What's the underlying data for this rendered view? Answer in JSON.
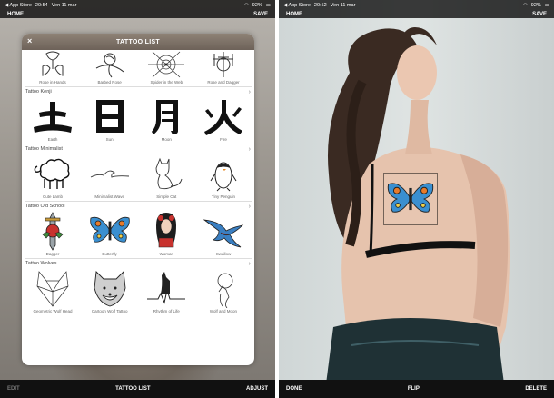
{
  "left": {
    "status": {
      "carrier": "◀ App Store",
      "time": "20:54",
      "date": "Ven 11 mar",
      "battery": "92%"
    },
    "topbar": {
      "home": "HOME",
      "save": "SAVE"
    },
    "panel": {
      "title": "TATTOO LIST",
      "first_row": [
        "Rose in Hands",
        "Barbed Rose",
        "Spider in the Web",
        "Rose and Dagger"
      ],
      "categories": [
        {
          "name": "Tattoo Kenji",
          "items": [
            "Earth",
            "Sun",
            "Moon",
            "Fire"
          ]
        },
        {
          "name": "Tattoo Minimalist",
          "items": [
            "Cute Lamb",
            "Minimalist Wave",
            "Simple Cat",
            "Tiny Penguin"
          ]
        },
        {
          "name": "Tattoo Old School",
          "items": [
            "Dagger",
            "Butterfly",
            "Woman",
            "Swallow"
          ]
        },
        {
          "name": "Tattoo Wolves",
          "items": [
            "Geometric Wolf Head",
            "Cartoon Wolf Tattoo",
            "Rhythm of Life",
            "Wolf and Moon"
          ]
        }
      ]
    },
    "bottombar": {
      "edit": "EDIT",
      "list": "TATTOO LIST",
      "adjust": "ADJUST"
    }
  },
  "right": {
    "status": {
      "carrier": "◀ App Store",
      "time": "20:52",
      "date": "Ven 11 mar",
      "battery": "92%"
    },
    "topbar": {
      "home": "HOME",
      "save": "SAVE"
    },
    "bottombar": {
      "done": "DONE",
      "flip": "FLIP",
      "delete": "DELETE"
    }
  },
  "colors": {
    "bar": "#111111",
    "panel_head": "#7d7167",
    "butterfly_wing": "#3a8fd0",
    "butterfly_accent": "#e87b2a"
  }
}
